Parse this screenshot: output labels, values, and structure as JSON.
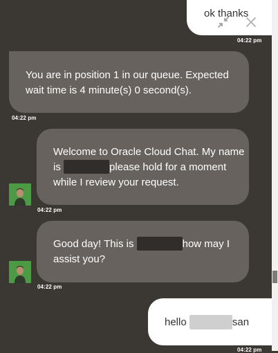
{
  "conversation": {
    "messages": [
      {
        "sender": "user",
        "text": "ok thanks",
        "time": "04:22 pm"
      },
      {
        "sender": "system",
        "text": "You are in position 1 in our queue. Expected wait time is 4 minute(s) 0 second(s).",
        "line1": "You are in position 1 in our queue. Expected",
        "line2": "wait time is 4 minute(s) 0 second(s).",
        "time": "04:22 pm"
      },
      {
        "sender": "agent",
        "line1": "Welcome to Oracle Cloud Chat. My name",
        "line2_pre": "is",
        "line2_post": "please hold for a moment",
        "line3": "while I review your request.",
        "time": "04:22 pm"
      },
      {
        "sender": "agent",
        "line1_pre": "Good day! This is",
        "line1_post": "how may I",
        "line2": "assist you?",
        "time": "04:22 pm"
      },
      {
        "sender": "user",
        "text_pre": "hello",
        "text_post": "san",
        "time": "04:22 pm"
      }
    ]
  },
  "controls": {
    "minimize_icon": "minimize-arrows-icon",
    "close_icon": "close-x-icon"
  },
  "colors": {
    "background": "#3b3733",
    "agent_bubble": "#67625d",
    "user_bubble": "#ffffff",
    "avatar_bg": "#4d9a45"
  }
}
